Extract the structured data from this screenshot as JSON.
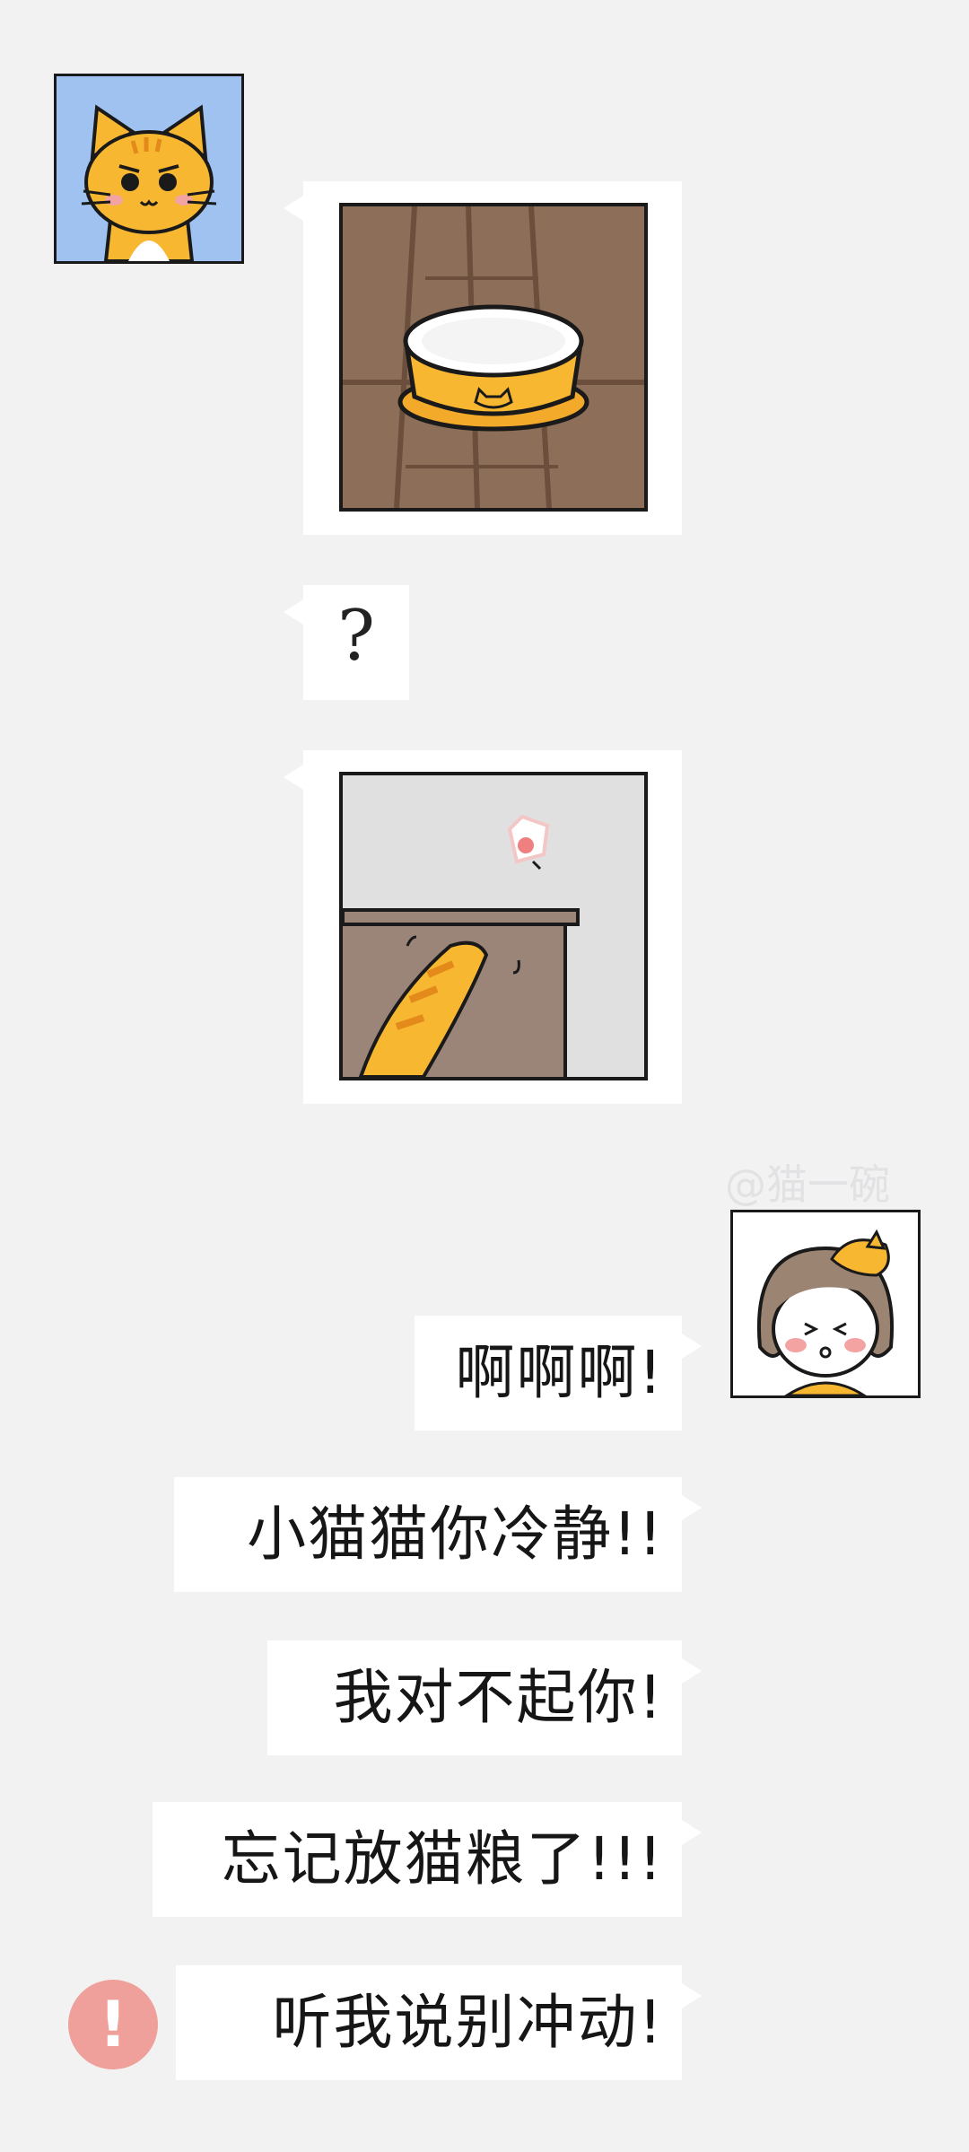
{
  "messages": {
    "question": "?",
    "msg1": "啊啊啊!",
    "msg2": "小猫猫你冷静!!",
    "msg3": "我对不起你!",
    "msg4": "忘记放猫粮了!!!",
    "msg5": "听我说别冲动!"
  },
  "watermark": "@猫一碗",
  "icons": {
    "cat_avatar": "orange-cat-avatar",
    "girl_avatar": "girl-with-cat-avatar",
    "error": "exclamation-alert-icon"
  },
  "colors": {
    "background": "#f3f2f3",
    "bubble": "#ffffff",
    "cat_avatar_bg": "#9fc2f0",
    "alert": "#f0a09a",
    "cat_orange": "#f7b731",
    "floor": "#8d6e58"
  }
}
